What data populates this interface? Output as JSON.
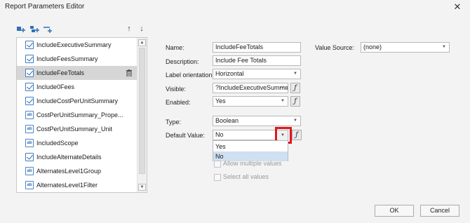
{
  "window": {
    "title": "Report Parameters Editor",
    "close_glyph": "✕"
  },
  "toolbar": {
    "icons": [
      "add-parameter-icon",
      "add-group-icon",
      "add-separator-icon"
    ],
    "move_up": "↑",
    "move_down": "↓"
  },
  "parameters": [
    {
      "label": "IncludeExecutiveSummary",
      "icon": "check",
      "selected": false
    },
    {
      "label": "IncludeFeesSummary",
      "icon": "check",
      "selected": false
    },
    {
      "label": "IncludeFeeTotals",
      "icon": "check",
      "selected": true
    },
    {
      "label": "Include0Fees",
      "icon": "check",
      "selected": false
    },
    {
      "label": "IncludeCostPerUnitSummary",
      "icon": "check",
      "selected": false
    },
    {
      "label": "CostPerUnitSummary_Prope...",
      "icon": "ab",
      "selected": false
    },
    {
      "label": "CostPerUnitSummary_Unit",
      "icon": "ab",
      "selected": false
    },
    {
      "label": "IncludedScope",
      "icon": "ab",
      "selected": false
    },
    {
      "label": "IncludeAlternateDetails",
      "icon": "check",
      "selected": false
    },
    {
      "label": "AlternatesLevel1Group",
      "icon": "ab",
      "selected": false
    },
    {
      "label": "AlternatesLevel1Filter",
      "icon": "ab",
      "selected": false
    }
  ],
  "form": {
    "name_label": "Name:",
    "name_value": "IncludeFeeTotals",
    "description_label": "Description:",
    "description_value": "Include Fee Totals",
    "orientation_label": "Label orientation:",
    "orientation_value": "Horizontal",
    "visible_label": "Visible:",
    "visible_value": "?IncludeExecutiveSumma",
    "enabled_label": "Enabled:",
    "enabled_value": "Yes",
    "type_label": "Type:",
    "type_value": "Boolean",
    "default_label": "Default Value:",
    "default_value": "No",
    "value_source_label": "Value Source:",
    "value_source_value": "(none)",
    "fx_glyph": "ƒ",
    "ellipsis": "···",
    "dropdown_glyph": "▼",
    "default_options": [
      "Yes",
      "No"
    ],
    "hovered_option": "No",
    "allow_multiple_label": "Allow multiple values",
    "select_all_label": "Select all values"
  },
  "colors": {
    "highlight": "#e0161d",
    "selected_row": "#d6d6d6",
    "hover_option": "#cfe0f1"
  },
  "buttons": {
    "ok": "OK",
    "cancel": "Cancel"
  }
}
